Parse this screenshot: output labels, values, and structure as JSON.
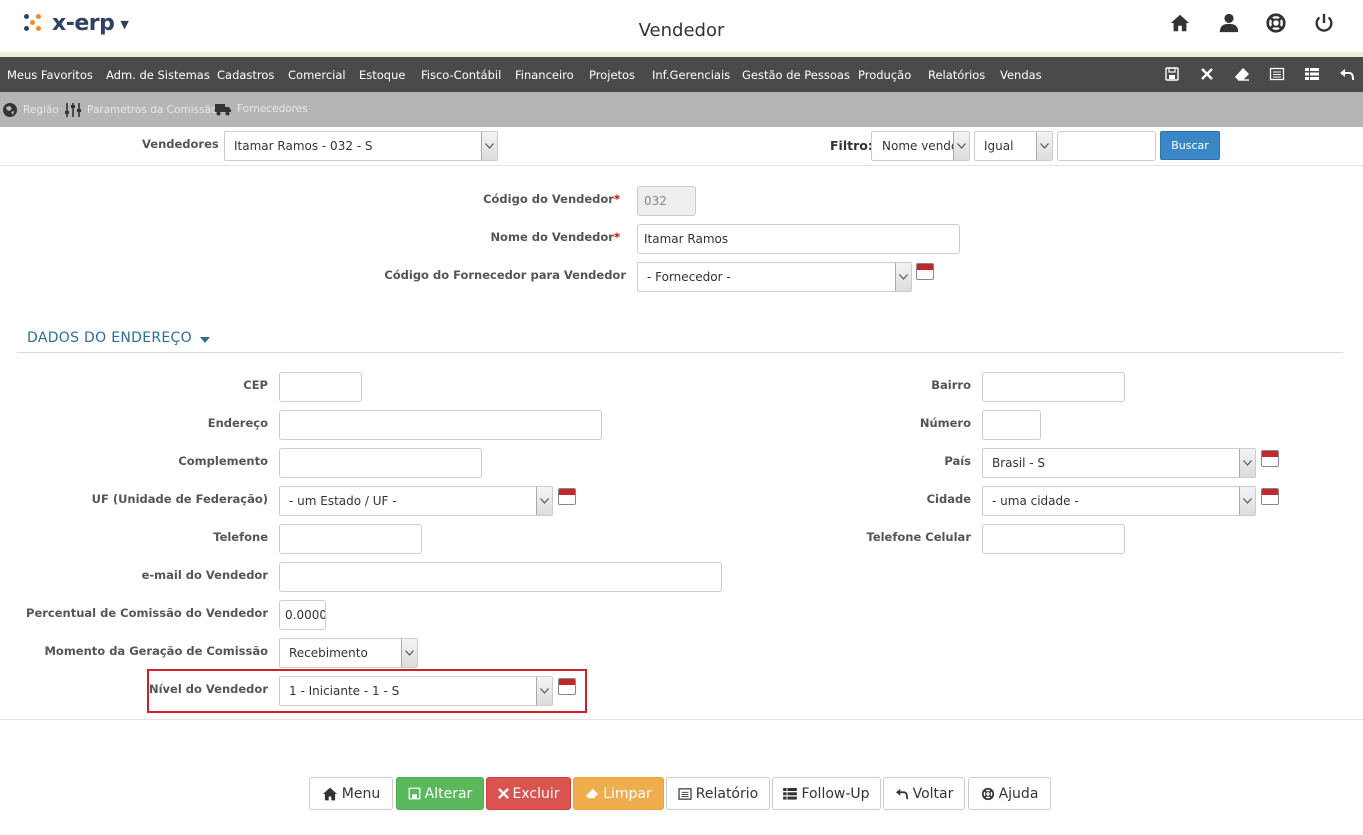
{
  "app": {
    "logo_text": "x-erp",
    "page_title": "Vendedor"
  },
  "menu": {
    "items": [
      "Meus Favoritos",
      "Adm. de Sistemas",
      "Cadastros",
      "Comercial",
      "Estoque",
      "Fisco-Contábil",
      "Financeiro",
      "Projetos",
      "Inf.Gerenciais",
      "Gestão de Pessoas",
      "Produção",
      "Relatórios",
      "Vendas"
    ],
    "tool_icons": [
      "save-icon",
      "close-icon",
      "eraser-icon",
      "list-alt-icon",
      "table-icon",
      "undo-icon"
    ]
  },
  "subbar": {
    "items": [
      "Região",
      "Parametros da Comissão",
      "Fornecedores"
    ]
  },
  "filter": {
    "vendedores_label": "Vendedores",
    "vendedores_value": "Itamar Ramos - 032 - S",
    "filtro_label": "Filtro:",
    "field_value": "Nome vendedor",
    "operator_value": "Igual",
    "search_value": "",
    "buscar_label": "Buscar"
  },
  "form": {
    "codigo_label": "Código do Vendedor",
    "codigo_value": "032",
    "nome_label": "Nome do Vendedor",
    "nome_value": "Itamar Ramos",
    "fornecedor_label": "Código do Fornecedor para Vendedor",
    "fornecedor_value": "- Fornecedor -",
    "required_mark": "*"
  },
  "section": {
    "title": "DADOS DO ENDEREÇO"
  },
  "address": {
    "cep_label": "CEP",
    "cep_value": "",
    "endereco_label": "Endereço",
    "endereco_value": "",
    "complemento_label": "Complemento",
    "complemento_value": "",
    "uf_label": "UF (Unidade de Federação)",
    "uf_value": "- um Estado / UF -",
    "telefone_label": "Telefone",
    "telefone_value": "",
    "email_label": "e-mail do Vendedor",
    "email_value": "",
    "percentual_label": "Percentual de Comissão do Vendedor",
    "percentual_value": "0.0000",
    "momento_label": "Momento da Geração de Comissão",
    "momento_value": "Recebimento",
    "nivel_label": "Nível do Vendedor",
    "nivel_value": "1 - Iniciante - 1 - S",
    "bairro_label": "Bairro",
    "bairro_value": "",
    "numero_label": "Número",
    "numero_value": "",
    "pais_label": "País",
    "pais_value": "Brasil - S",
    "cidade_label": "Cidade",
    "cidade_value": "- uma cidade -",
    "celular_label": "Telefone Celular",
    "celular_value": ""
  },
  "footer": {
    "menu": "Menu",
    "alterar": "Alterar",
    "excluir": "Excluir",
    "limpar": "Limpar",
    "relatorio": "Relatório",
    "followup": "Follow-Up",
    "voltar": "Voltar",
    "ajuda": "Ajuda"
  },
  "colors": {
    "menu_bg": "#4a4a4a",
    "subbar_bg": "#b5b5b5",
    "section_title": "#2c6e9b",
    "highlight": "#d32027",
    "buscar": "#3a87c8",
    "alterar": "#5cb85c",
    "excluir": "#d9534f",
    "limpar": "#f0ad4e"
  }
}
